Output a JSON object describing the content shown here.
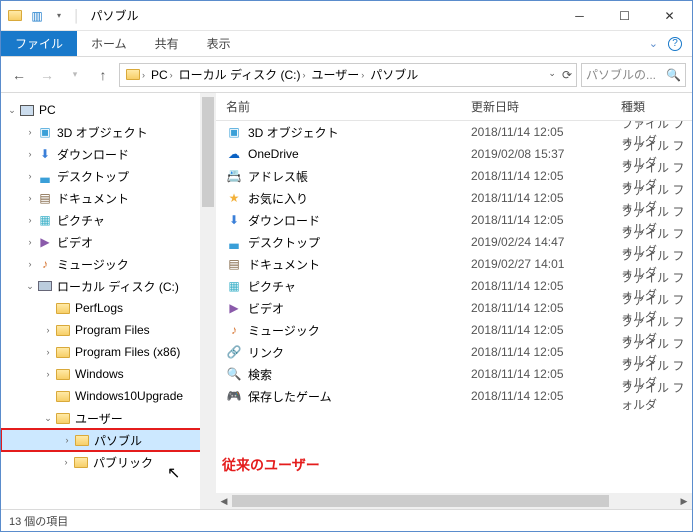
{
  "window": {
    "title": "パソブル"
  },
  "ribbon": {
    "file": "ファイル",
    "tabs": [
      "ホーム",
      "共有",
      "表示"
    ]
  },
  "breadcrumb": [
    "PC",
    "ローカル ディスク (C:)",
    "ユーザー",
    "パソブル"
  ],
  "search": {
    "placeholder": "パソブルの..."
  },
  "columns": {
    "name": "名前",
    "date": "更新日時",
    "type": "種類"
  },
  "tree": [
    {
      "indent": 0,
      "arrow": "v",
      "icon": "pc",
      "label": "PC"
    },
    {
      "indent": 1,
      "arrow": ">",
      "icon": "3d",
      "label": "3D オブジェクト"
    },
    {
      "indent": 1,
      "arrow": ">",
      "icon": "dl",
      "label": "ダウンロード"
    },
    {
      "indent": 1,
      "arrow": ">",
      "icon": "desk",
      "label": "デスクトップ"
    },
    {
      "indent": 1,
      "arrow": ">",
      "icon": "doc",
      "label": "ドキュメント"
    },
    {
      "indent": 1,
      "arrow": ">",
      "icon": "pic",
      "label": "ピクチャ"
    },
    {
      "indent": 1,
      "arrow": ">",
      "icon": "vid",
      "label": "ビデオ"
    },
    {
      "indent": 1,
      "arrow": ">",
      "icon": "mus",
      "label": "ミュージック"
    },
    {
      "indent": 1,
      "arrow": "v",
      "icon": "drive",
      "label": "ローカル ディスク (C:)"
    },
    {
      "indent": 2,
      "arrow": "",
      "icon": "folder",
      "label": "PerfLogs"
    },
    {
      "indent": 2,
      "arrow": ">",
      "icon": "folder",
      "label": "Program Files"
    },
    {
      "indent": 2,
      "arrow": ">",
      "icon": "folder",
      "label": "Program Files (x86)"
    },
    {
      "indent": 2,
      "arrow": ">",
      "icon": "folder",
      "label": "Windows"
    },
    {
      "indent": 2,
      "arrow": "",
      "icon": "folder",
      "label": "Windows10Upgrade"
    },
    {
      "indent": 2,
      "arrow": "v",
      "icon": "folder",
      "label": "ユーザー"
    },
    {
      "indent": 3,
      "arrow": ">",
      "icon": "folder",
      "label": "パソブル",
      "selected": true
    },
    {
      "indent": 3,
      "arrow": ">",
      "icon": "folder",
      "label": "パブリック"
    }
  ],
  "annotation": "従来のユーザー",
  "files": [
    {
      "icon": "3d",
      "name": "3D オブジェクト",
      "date": "2018/11/14 12:05",
      "type": "ファイル フォルダ"
    },
    {
      "icon": "cloud",
      "name": "OneDrive",
      "date": "2019/02/08 15:37",
      "type": "ファイル フォルダ"
    },
    {
      "icon": "addr",
      "name": "アドレス帳",
      "date": "2018/11/14 12:05",
      "type": "ファイル フォルダ"
    },
    {
      "icon": "fav",
      "name": "お気に入り",
      "date": "2018/11/14 12:05",
      "type": "ファイル フォルダ"
    },
    {
      "icon": "dl",
      "name": "ダウンロード",
      "date": "2018/11/14 12:05",
      "type": "ファイル フォルダ"
    },
    {
      "icon": "desk",
      "name": "デスクトップ",
      "date": "2019/02/24 14:47",
      "type": "ファイル フォルダ"
    },
    {
      "icon": "doc",
      "name": "ドキュメント",
      "date": "2019/02/27 14:01",
      "type": "ファイル フォルダ"
    },
    {
      "icon": "pic",
      "name": "ピクチャ",
      "date": "2018/11/14 12:05",
      "type": "ファイル フォルダ"
    },
    {
      "icon": "vid",
      "name": "ビデオ",
      "date": "2018/11/14 12:05",
      "type": "ファイル フォルダ"
    },
    {
      "icon": "mus",
      "name": "ミュージック",
      "date": "2018/11/14 12:05",
      "type": "ファイル フォルダ"
    },
    {
      "icon": "link",
      "name": "リンク",
      "date": "2018/11/14 12:05",
      "type": "ファイル フォルダ"
    },
    {
      "icon": "search",
      "name": "検索",
      "date": "2018/11/14 12:05",
      "type": "ファイル フォルダ"
    },
    {
      "icon": "game",
      "name": "保存したゲーム",
      "date": "2018/11/14 12:05",
      "type": "ファイル フォルダ"
    }
  ],
  "status": "13 個の項目"
}
